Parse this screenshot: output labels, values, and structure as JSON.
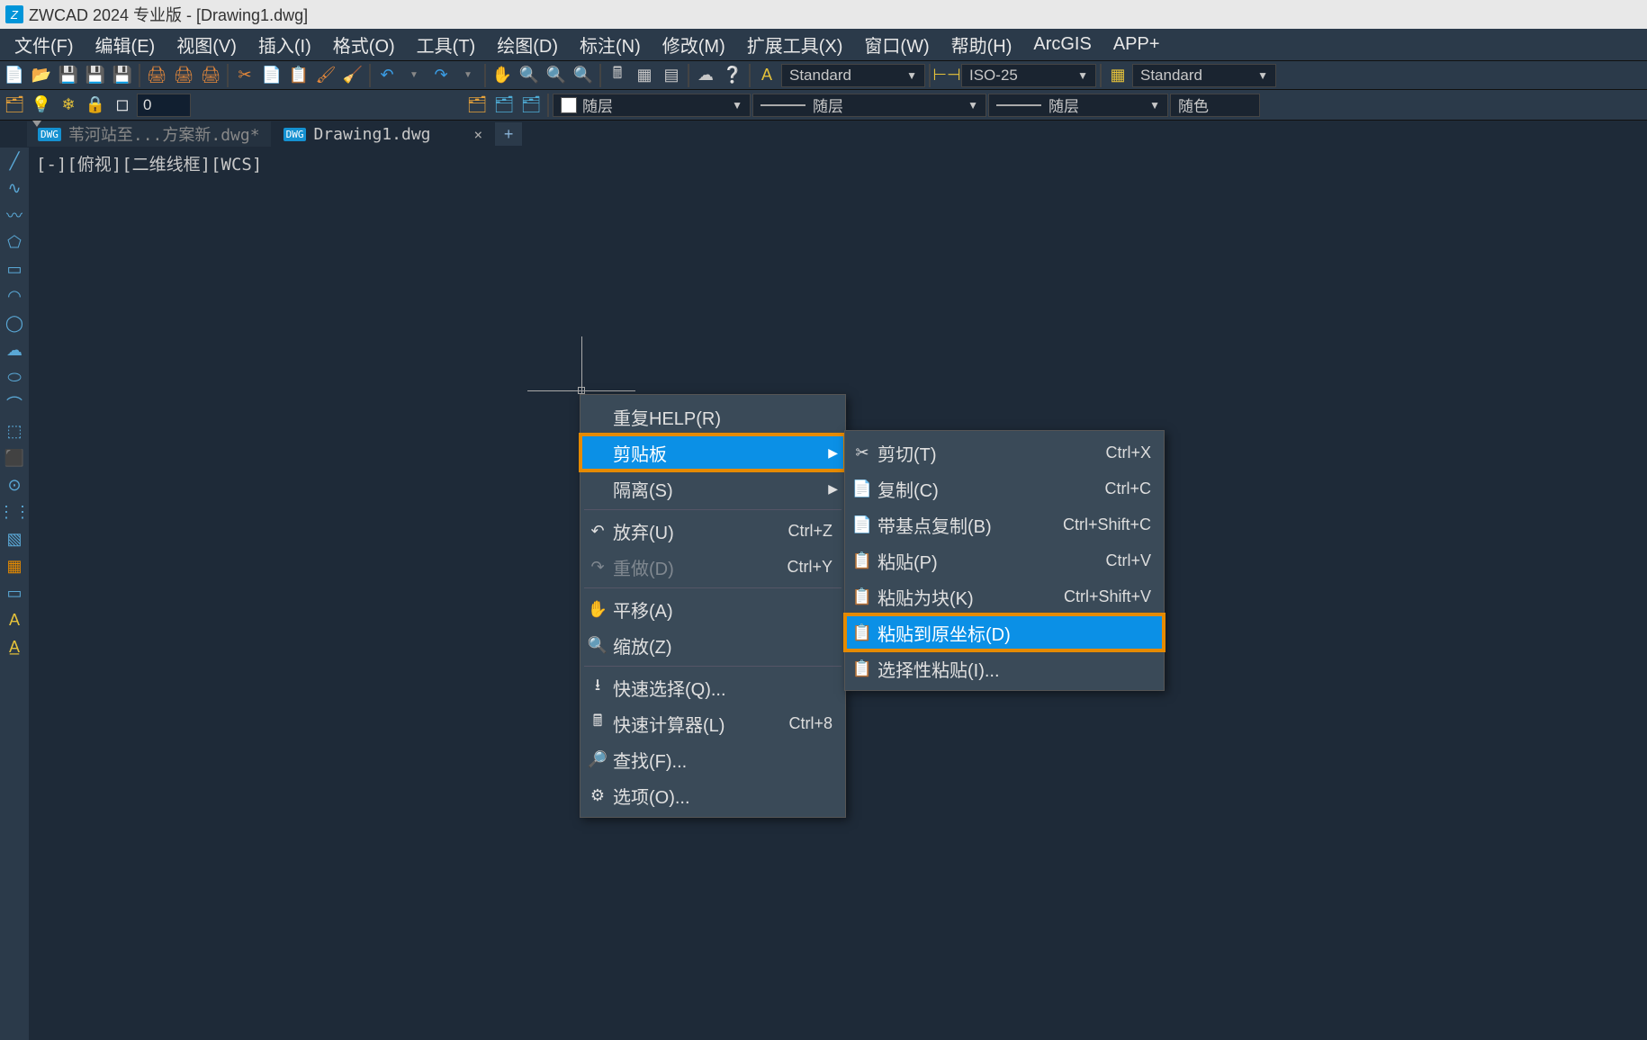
{
  "title": "ZWCAD 2024 专业版 - [Drawing1.dwg]",
  "menus": [
    "文件(F)",
    "编辑(E)",
    "视图(V)",
    "插入(I)",
    "格式(O)",
    "工具(T)",
    "绘图(D)",
    "标注(N)",
    "修改(M)",
    "扩展工具(X)",
    "窗口(W)",
    "帮助(H)",
    "ArcGIS",
    "APP+"
  ],
  "layer_value": "0",
  "styles": {
    "text": "Standard",
    "dim": "ISO-25",
    "table": "Standard"
  },
  "props": {
    "color_label": "随层",
    "linetype_label": "随层",
    "lineweight_label": "随层",
    "plotstyle_label": "随色"
  },
  "tabs": {
    "inactive": "苇河站至...方案新.dwg*",
    "active": "Drawing1.dwg"
  },
  "viewlabels": "[-][俯视][二维线框][WCS]",
  "context1": [
    {
      "label": "重复HELP(R)",
      "icon": ""
    },
    {
      "label": "剪贴板",
      "icon": "",
      "sub": true,
      "sel": true,
      "hl": true
    },
    {
      "label": "隔离(S)",
      "icon": "",
      "sub": true
    },
    {
      "sep": true
    },
    {
      "label": "放弃(U)",
      "icon": "↶",
      "shortcut": "Ctrl+Z"
    },
    {
      "label": "重做(D)",
      "icon": "↷",
      "shortcut": "Ctrl+Y",
      "disabled": true
    },
    {
      "sep": true
    },
    {
      "label": "平移(A)",
      "icon": "✋"
    },
    {
      "label": "缩放(Z)",
      "icon": "🔍"
    },
    {
      "sep": true
    },
    {
      "label": "快速选择(Q)...",
      "icon": "⭳"
    },
    {
      "label": "快速计算器(L)",
      "icon": "🖩",
      "shortcut": "Ctrl+8"
    },
    {
      "label": "查找(F)...",
      "icon": "🔎"
    },
    {
      "label": "选项(O)...",
      "icon": "⚙"
    }
  ],
  "context2": [
    {
      "label": "剪切(T)",
      "icon": "✂",
      "shortcut": "Ctrl+X"
    },
    {
      "label": "复制(C)",
      "icon": "📄",
      "shortcut": "Ctrl+C"
    },
    {
      "label": "带基点复制(B)",
      "icon": "📄",
      "shortcut": "Ctrl+Shift+C"
    },
    {
      "label": "粘贴(P)",
      "icon": "📋",
      "shortcut": "Ctrl+V"
    },
    {
      "label": "粘贴为块(K)",
      "icon": "📋",
      "shortcut": "Ctrl+Shift+V"
    },
    {
      "label": "粘贴到原坐标(D)",
      "icon": "📋",
      "sel": true,
      "hl": true
    },
    {
      "label": "选择性粘贴(I)...",
      "icon": "📋"
    }
  ]
}
